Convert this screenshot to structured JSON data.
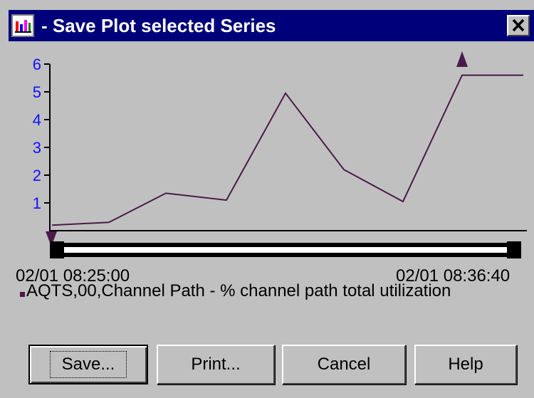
{
  "window": {
    "title": "- Save Plot  selected Series",
    "close_glyph": "✕"
  },
  "chart_data": {
    "type": "line",
    "y_ticks": [
      "1",
      "2",
      "3",
      "4",
      "5",
      "6"
    ],
    "ylim": [
      0,
      6
    ],
    "x_start_label": "02/01 08:25:00",
    "x_end_label": "02/01 08:36:40",
    "series": [
      {
        "name": "AQTS,00,Channel Path - % channel path total utilization",
        "color": "#4a1a4a",
        "x": [
          0,
          1,
          2,
          3,
          4,
          5,
          6,
          7,
          8
        ],
        "values": [
          0.2,
          0.3,
          1.35,
          1.1,
          4.95,
          2.2,
          1.05,
          5.6,
          5.6
        ]
      }
    ],
    "grid": false,
    "legend_position": "bottom"
  },
  "buttons": {
    "save": "Save...",
    "print": "Print...",
    "cancel": "Cancel",
    "help": "Help"
  }
}
